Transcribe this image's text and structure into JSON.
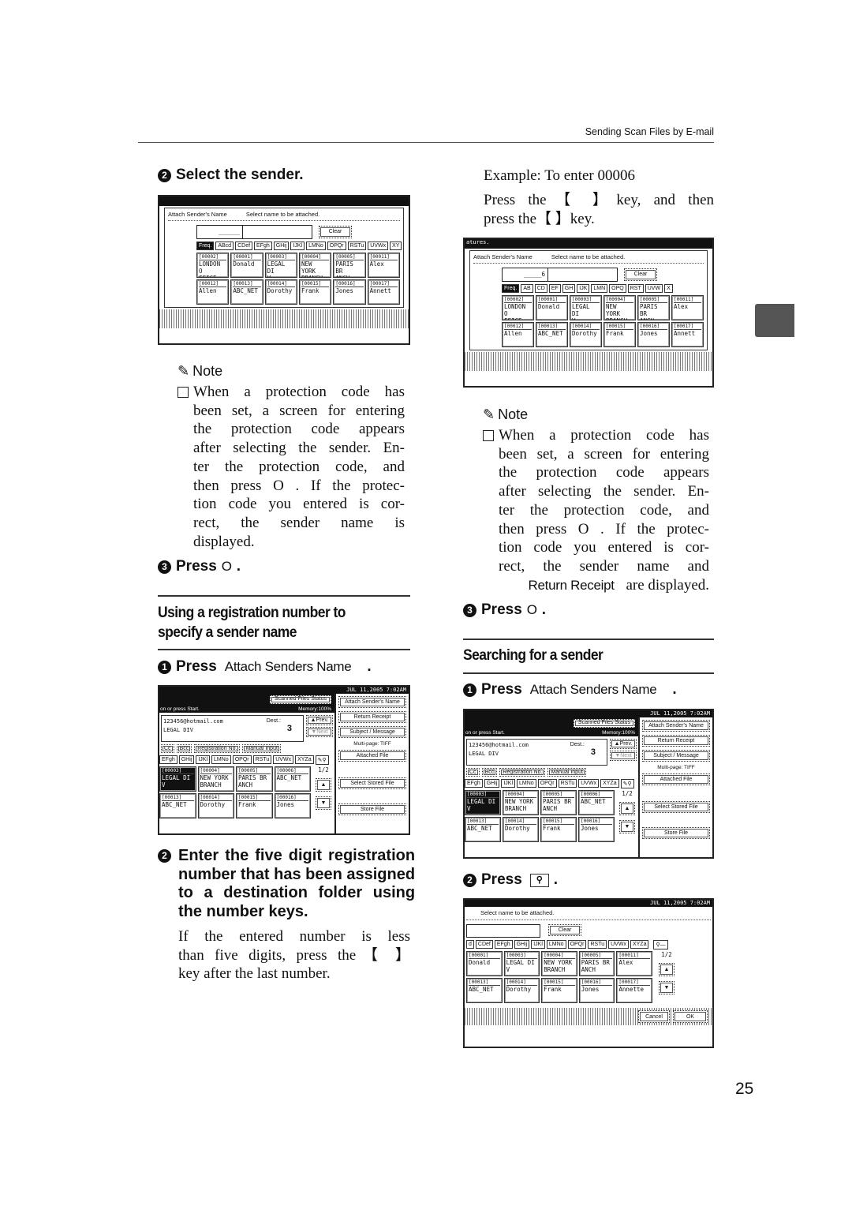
{
  "header": {
    "running_title": "Sending Scan Files by E-mail"
  },
  "page_number": "25",
  "left": {
    "step2": {
      "num": "2",
      "text": "Select the sender."
    },
    "note": {
      "heading": "Note",
      "lines": [
        "When a protection code has",
        "been set, a screen for entering",
        "the protection code appears",
        "after selecting the sender. En-",
        "ter the protection code, and",
        "then press O   . If the protec-",
        "tion code you entered is cor-",
        "rect, the sender name is",
        "displayed."
      ]
    },
    "step3": {
      "num": "3",
      "press": "Press",
      "key": "O",
      "end": "."
    },
    "section_title_1": "Using a registration number to",
    "section_title_2": "specify a sender name",
    "sub1": {
      "num": "1",
      "press": "Press",
      "key": "Attach Senders Name",
      "end": "."
    },
    "sub2": {
      "num": "2",
      "lines": [
        "Enter the five digit registration",
        "number that has been assigned",
        "to a destination folder using",
        "the number keys."
      ]
    },
    "sub2_body": [
      "If the entered number is less",
      "than five digits, press the【  】",
      "key after the last number."
    ]
  },
  "right": {
    "example": "Example: To enter 00006",
    "press_lines": [
      "Press the【  】key, and then",
      "press the【  】key."
    ],
    "note": {
      "heading": "Note",
      "lines": [
        "When a protection code has",
        "been set, a screen for entering",
        "the protection code appears",
        "after selecting the sender. En-",
        "ter the protection code, and",
        "then press O   . If the protec-",
        "tion code you entered is cor-",
        "rect, the sender name and"
      ],
      "last_key": "Return Receipt",
      "last_text": "are displayed."
    },
    "step3": {
      "num": "3",
      "press": "Press",
      "key": "O",
      "end": "."
    },
    "section_title": "Searching for a sender",
    "sub1": {
      "num": "1",
      "press": "Press",
      "key": "Attach Senders Name",
      "end": "."
    },
    "sub2": {
      "num": "2",
      "press": "Press",
      "icon": "search-key-icon",
      "end": "."
    }
  },
  "screens": {
    "s1": {
      "title": "Attach Sender's Name",
      "instruction": "Select name to be attached.",
      "input": "______",
      "clear": "Clear",
      "tabs": [
        "Freq.",
        "ABcd",
        "CDef",
        "EFgh",
        "GHij",
        "IJKl",
        "LMNo",
        "OPQr",
        "RSTu",
        "UVWx",
        "XY"
      ],
      "cells": [
        [
          "[00002]",
          "LONDON O",
          "FFICE"
        ],
        [
          "[00001]",
          "Donald",
          ""
        ],
        [
          "[00003]",
          "LEGAL DI",
          "V"
        ],
        [
          "[00004]",
          "NEW YORK",
          " BRANCH"
        ],
        [
          "[00005]",
          "PARIS BR",
          "ANCH"
        ],
        [
          "[00011]",
          "Alex",
          ""
        ],
        [
          "[00012]",
          "Allen",
          ""
        ],
        [
          "[00013]",
          "ABC_NET",
          ""
        ],
        [
          "[00014]",
          "Dorothy",
          ""
        ],
        [
          "[00015]",
          "Frank",
          ""
        ],
        [
          "[00016]",
          "Jones",
          ""
        ],
        [
          "[00017]",
          "Annett",
          ""
        ]
      ]
    },
    "s2": {
      "top": "atures.",
      "title": "Attach Sender's Name",
      "instruction": "Select name to be attached.",
      "input": "_____6",
      "clear": "Clear",
      "tabs": [
        "Freq.",
        "AB",
        "CD",
        "EF",
        "GH",
        "IJK",
        "LMN",
        "OPQ",
        "RST",
        "UVW",
        "X"
      ],
      "cells": [
        [
          "[00002]",
          "LONDON O",
          "FFICE"
        ],
        [
          "[00001]",
          "Donald",
          ""
        ],
        [
          "[00003]",
          "LEGAL DI",
          "V"
        ],
        [
          "[00004]",
          "NEW YORK",
          " BRANCH"
        ],
        [
          "[00005]",
          "PARIS BR",
          "ANCH"
        ],
        [
          "[00011]",
          "Alex",
          ""
        ],
        [
          "[00012]",
          "Allen",
          ""
        ],
        [
          "[00013]",
          "ABC_NET",
          ""
        ],
        [
          "[00014]",
          "Dorothy",
          ""
        ],
        [
          "[00015]",
          "Frank",
          ""
        ],
        [
          "[00016]",
          "Jones",
          ""
        ],
        [
          "[00017]",
          "Annett",
          ""
        ]
      ]
    },
    "s3": {
      "date": "JUL  11,2005  7:02AM",
      "scanned": "Scanned Files Status",
      "prompt": "on or press Start.",
      "memory": "Memory:100%",
      "email": "123456@hotmail.com",
      "name": "LEGAL DIV",
      "dest_label": "Dest.:",
      "dest": "3",
      "prev": "▲Prev.",
      "next": "▼Next",
      "modes": [
        "Cc",
        "Bcc",
        "Registration No.",
        "Manual Input"
      ],
      "tabs": [
        "EFgh",
        "GHij",
        "IJKl",
        "LMNo",
        "OPQr",
        "RSTu",
        "UVWx",
        "XYZa"
      ],
      "cells": [
        [
          "[00003]",
          "LEGAL DI",
          "V"
        ],
        [
          "[00004]",
          "NEW YORK",
          " BRANCH"
        ],
        [
          "[00005]",
          "PARIS BR",
          "ANCH"
        ],
        [
          "[00006]",
          "ABC_NET",
          ""
        ],
        [
          "[00013]",
          "ABC_NET",
          ""
        ],
        [
          "[00014]",
          "Dorothy",
          ""
        ],
        [
          "[00015]",
          "Frank",
          ""
        ],
        [
          "[00016]",
          "Jones",
          ""
        ]
      ],
      "page": "1/2",
      "side": [
        "Attach Sender's Name",
        "Return Receipt",
        "Subject / Message"
      ],
      "multipage": "Multi-page: TIFF",
      "side2": [
        "Attached File",
        "Select Stored File",
        "Store File"
      ]
    },
    "s5": {
      "date": "JUL  11,2005  7:02AM",
      "instruction": "Select name to be attached.",
      "clear": "Clear",
      "tabs": [
        "d",
        "CDef",
        "EFgh",
        "GHij",
        "IJKl",
        "LMNo",
        "OPQr",
        "RSTu",
        "UVWx",
        "XYZa"
      ],
      "cells": [
        [
          "[00001]",
          "Donald",
          ""
        ],
        [
          "[00003]",
          "LEGAL DI",
          "V"
        ],
        [
          "[00004]",
          "NEW YORK",
          " BRANCH"
        ],
        [
          "[00005]",
          "PARIS BR",
          "ANCH"
        ],
        [
          "[00011]",
          "Alex",
          ""
        ],
        [
          "[00013]",
          "ABC_NET",
          ""
        ],
        [
          "[00014]",
          "Dorothy",
          ""
        ],
        [
          "[00015]",
          "Frank",
          ""
        ],
        [
          "[00016]",
          "Jones",
          ""
        ],
        [
          "[00017]",
          "Annette",
          ""
        ]
      ],
      "page": "1/2",
      "cancel": "Cancel",
      "ok": "OK"
    }
  }
}
